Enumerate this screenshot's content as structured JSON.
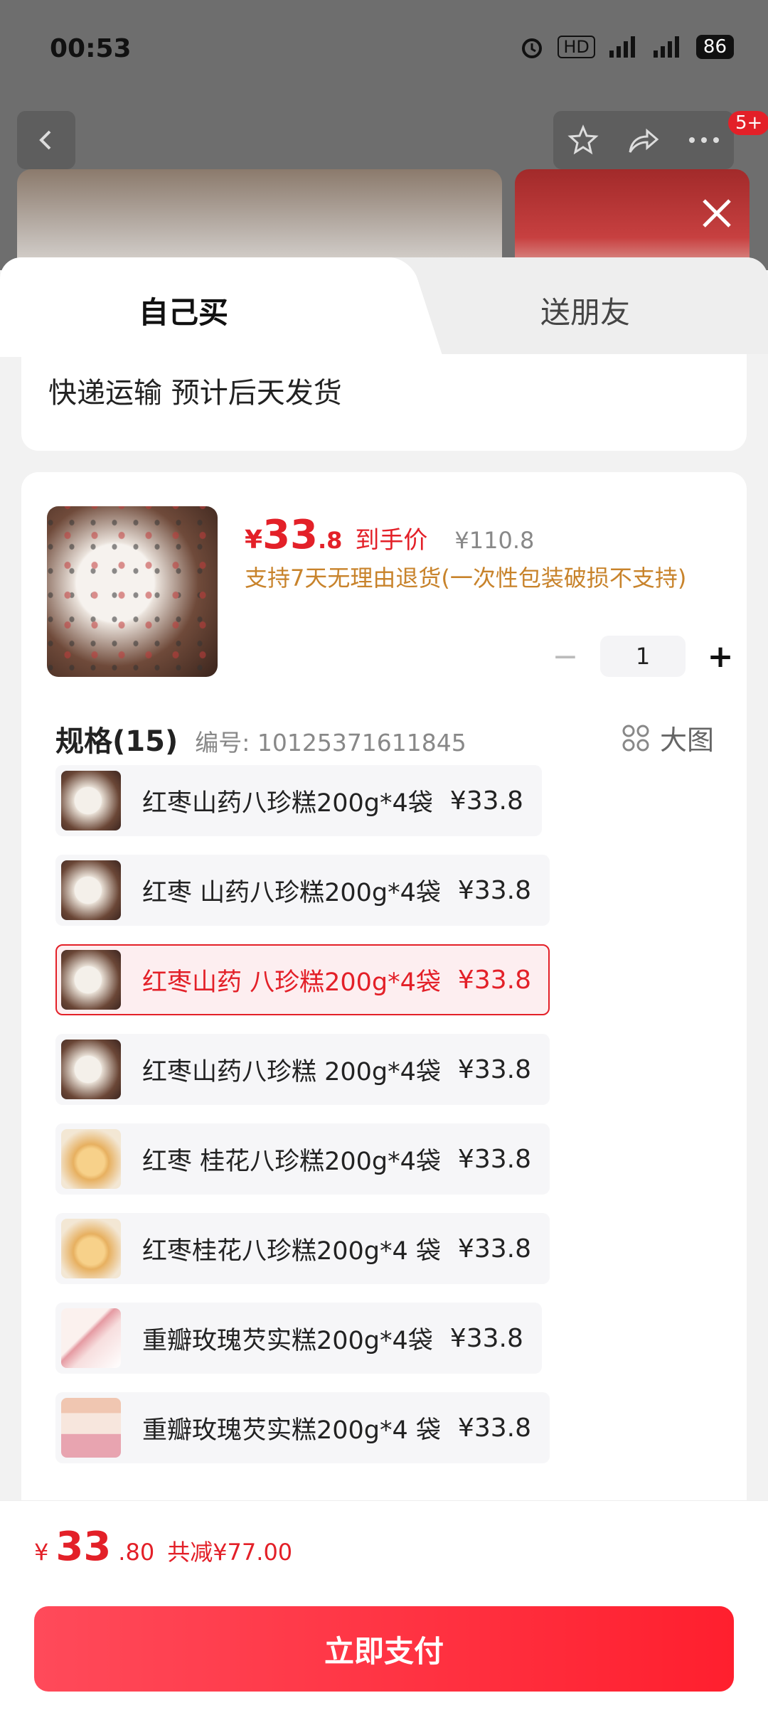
{
  "status_bar": {
    "time": "00:53",
    "hd": "HD",
    "battery": "86"
  },
  "top_nav": {
    "badge": "5+"
  },
  "tabs": {
    "self_buy": "自己买",
    "gift": "送朋友"
  },
  "shipping": {
    "text": "快递运输 预计后天发货"
  },
  "product": {
    "currency": "¥",
    "price_int": "33",
    "price_dec": ".8",
    "price_tag": "到手价",
    "original_price": "¥110.8",
    "return_policy": "支持7天无理由退货(一次性包装破损不支持)",
    "quantity": "1"
  },
  "spec": {
    "title": "规格(15)",
    "code": "编号: 10125371611845",
    "big_view": "大图",
    "items": [
      {
        "name": "红枣山药八珍糕200g*4袋",
        "price": "¥33.8"
      },
      {
        "name": "红枣 山药八珍糕200g*4袋",
        "price": "¥33.8"
      },
      {
        "name": "红枣山药 八珍糕200g*4袋",
        "price": "¥33.8"
      },
      {
        "name": "红枣山药八珍糕 200g*4袋",
        "price": "¥33.8"
      },
      {
        "name": "红枣 桂花八珍糕200g*4袋",
        "price": "¥33.8"
      },
      {
        "name": "红枣桂花八珍糕200g*4 袋",
        "price": "¥33.8"
      },
      {
        "name": "重瓣玫瑰芡实糕200g*4袋",
        "price": "¥33.8"
      },
      {
        "name": "重瓣玫瑰芡实糕200g*4 袋",
        "price": "¥33.8"
      }
    ],
    "selected_index": 2
  },
  "bottom": {
    "currency": "¥",
    "price_int": "33",
    "price_dec": ".80",
    "savings": "共减¥77.00",
    "pay_label": "立即支付"
  },
  "colors": {
    "accent": "#e32028",
    "policy": "#c8832b"
  }
}
